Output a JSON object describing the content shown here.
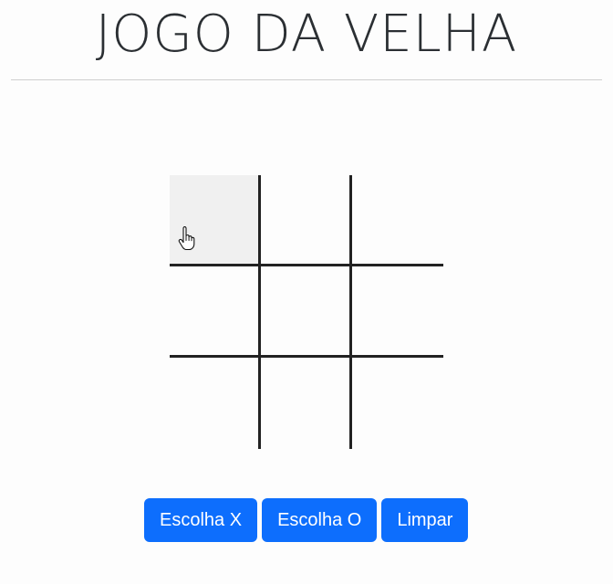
{
  "header": {
    "title": "JOGO DA VELHA"
  },
  "board": {
    "cells": [
      "",
      "",
      "",
      "",
      "",
      "",
      "",
      "",
      ""
    ],
    "hovered_cell": 0
  },
  "controls": {
    "choose_x_label": "Escolha X",
    "choose_o_label": "Escolha O",
    "clear_label": "Limpar"
  },
  "colors": {
    "button": "#0d6efd",
    "grid_line": "#222222",
    "hover_cell": "#f0f0f0"
  }
}
